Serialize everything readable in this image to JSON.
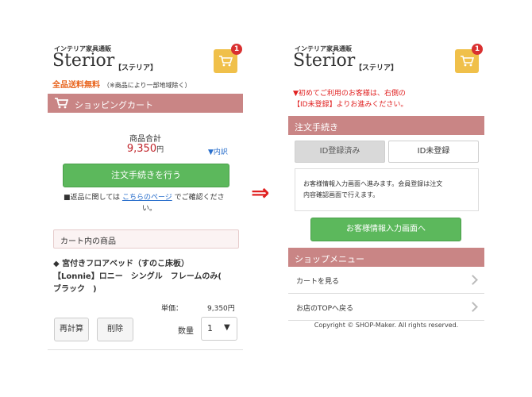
{
  "left": {
    "brand": {
      "sub": "インテリア家具通販",
      "name": "Sterior",
      "kana": "【ステリア】"
    },
    "cart_count": "1",
    "free_shipping": {
      "highlight": "全品送料無料",
      "note": "（※商品により一部地域除く）"
    },
    "cart_header": "ショッピングカート",
    "subtotal": {
      "label": "商品合計",
      "amount": "9,350",
      "unit": "円",
      "detail_link": "▼内訳"
    },
    "checkout_button": "注文手続きを行う",
    "return_note": {
      "prefix": "■返品に関しては",
      "link": "こちらのページ",
      "suffix_line1": "でご確認くださ",
      "suffix_line2": "い。"
    },
    "cart_items_header": "カート内の商品",
    "item": {
      "line1": "◆ 宮付きフロアベッド（すのこ床板）",
      "line2": "【Lonnie】ロニー　シングル　フレームのみ(",
      "line3": "ブラック　)",
      "unit_price_label": "単価：",
      "unit_price": "9,350円"
    },
    "recalc_button": "再計算",
    "delete_button": "削除",
    "quantity_label": "数量",
    "quantity_value": "1"
  },
  "arrow": "⇒",
  "right": {
    "brand": {
      "sub": "インテリア家具通販",
      "name": "Sterior",
      "kana": "【ステリア】"
    },
    "cart_count": "1",
    "notice_line1": "▼初めてご利用のお客様は、右側の",
    "notice_line2": "【ID未登録】よりお進みください。",
    "order_header": "注文手続き",
    "tab_registered": "ID登録済み",
    "tab_unregistered": "ID未登録",
    "info_line1": "お客様情報入力画面へ進みます。会員登録は注文",
    "info_line2": "内容確認画面で行えます。",
    "proceed_button": "お客様情報入力画面へ",
    "shop_menu_header": "ショップメニュー",
    "menu": [
      {
        "label": "カートを見る"
      },
      {
        "label": "お店のTOPへ戻る"
      }
    ],
    "copyright": "Copyright © SHOP-Maker. All rights reserved."
  },
  "colors": {
    "section_bar": "#c98585",
    "green_button": "#5cb85c",
    "cart_badge": "#f0c04a",
    "notice_red": "#e02020",
    "free_ship_orange": "#e8621a",
    "price_red": "#c0242a"
  }
}
